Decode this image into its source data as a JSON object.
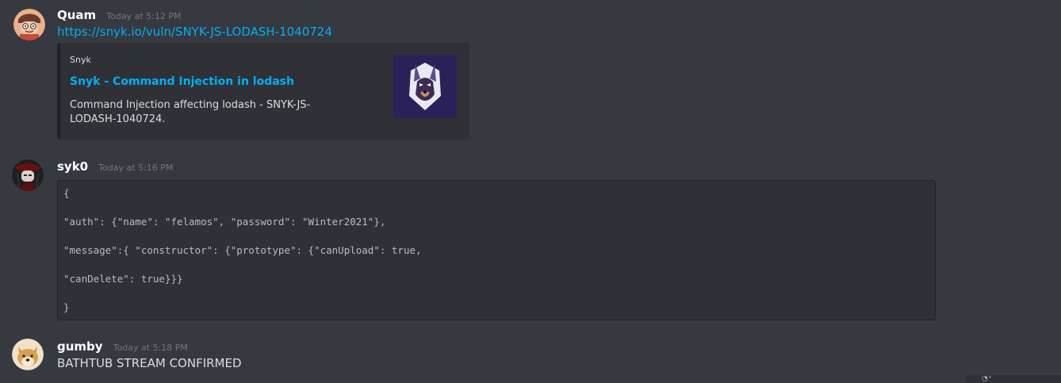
{
  "messages": [
    {
      "username": "Quam",
      "timestamp": "Today at 5:12 PM",
      "link": "https://snyk.io/vuln/SNYK-JS-LODASH-1040724",
      "embed": {
        "provider": "Snyk",
        "title": "Snyk - Command Injection in lodash",
        "description": "Command Injection affecting lodash - SNYK-JS-LODASH-1040724."
      }
    },
    {
      "username": "syk0",
      "timestamp": "Today at 5:16 PM",
      "code_lines": [
        "{",
        "\"auth\": {\"name\": \"felamos\", \"password\": \"Winter2021\"},",
        "\"message\":{ \"constructor\": {\"prototype\": {\"canUpload\": true,",
        "\"canDelete\": true}}}",
        "}"
      ]
    },
    {
      "username": "gumby",
      "timestamp": "Today at 5:18 PM",
      "text": "BATHTUB STREAM CONFIRMED"
    }
  ],
  "colors": {
    "background": "#36393f",
    "embed_bg": "#2f3136",
    "link": "#00b0f4",
    "username": "#ffffff",
    "timestamp": "#72767d"
  },
  "icons": {
    "avatar1": "cartoon-avatar-icon",
    "avatar2": "dark-character-avatar-icon",
    "avatar3": "doge-avatar-icon",
    "embed_thumb": "snyk-dog-logo-icon"
  }
}
